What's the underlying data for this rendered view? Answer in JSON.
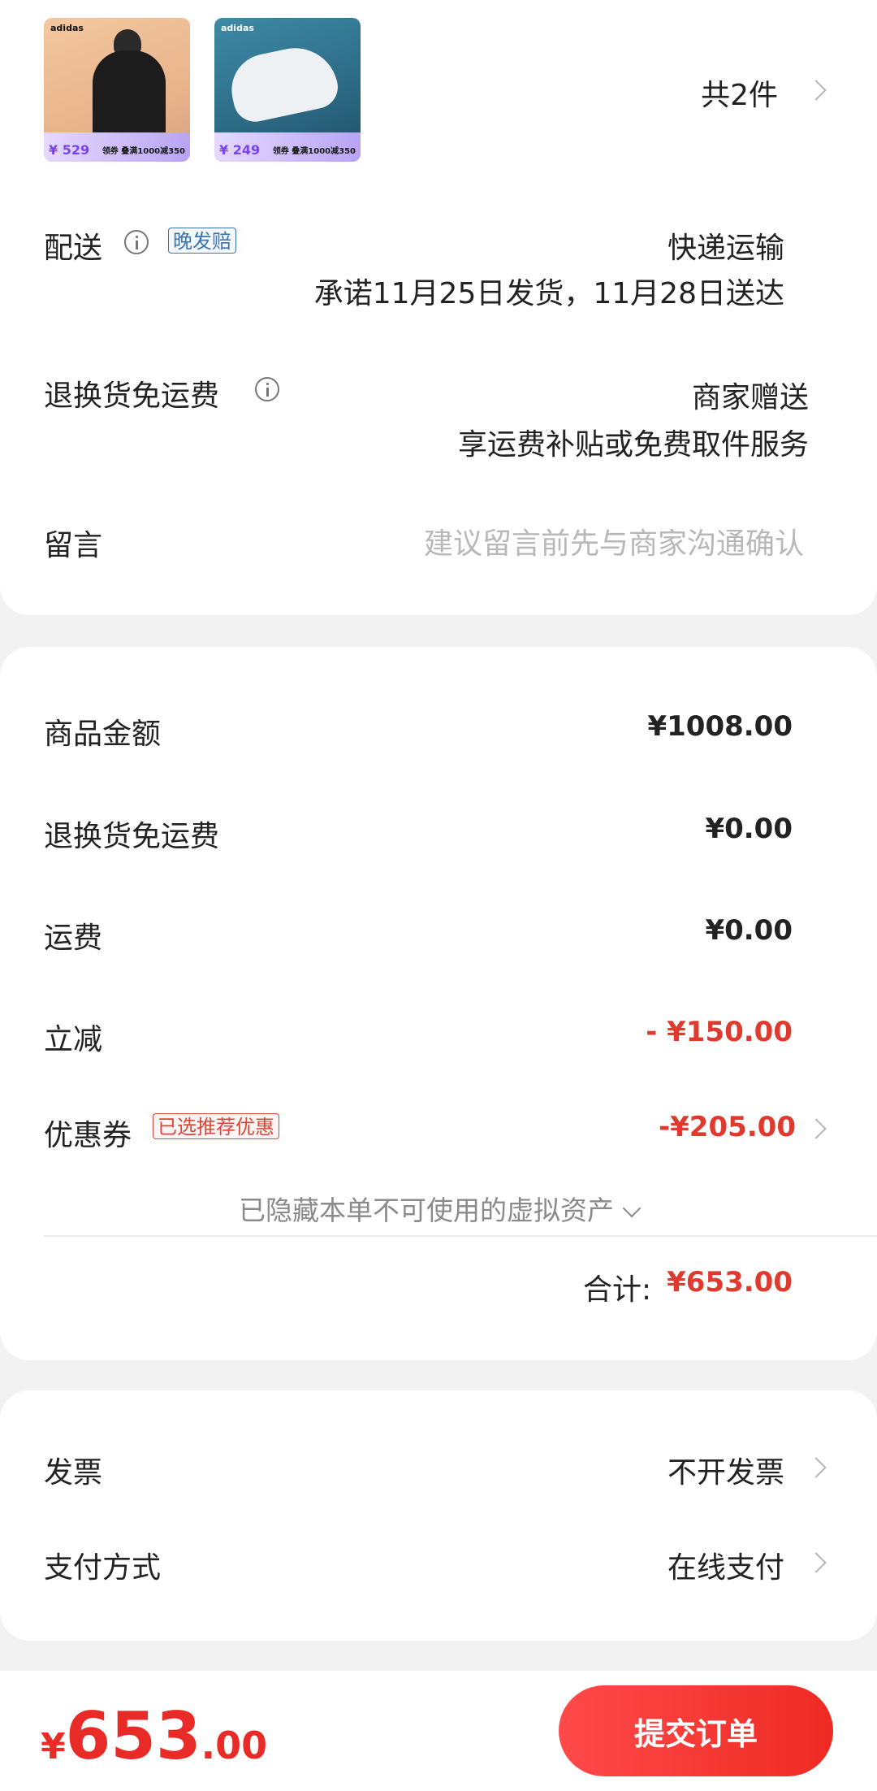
{
  "items": {
    "count_label": "共2件",
    "thumbs": [
      {
        "logo": "adidas",
        "price": "¥ 529",
        "deal": "领券 叠满1000减350"
      },
      {
        "logo": "adidas",
        "price": "¥ 249",
        "deal": "领券 叠满1000减350"
      }
    ]
  },
  "delivery": {
    "label": "配送",
    "tag": "晚发赔",
    "method": "快递运输",
    "promise": "承诺11月25日发货，11月28日送达"
  },
  "return_shipping": {
    "label": "退换货免运费",
    "value": "商家赠送",
    "desc": "享运费补贴或免费取件服务"
  },
  "message": {
    "label": "留言",
    "placeholder": "建议留言前先与商家沟通确认"
  },
  "summary": {
    "goods_amount_label": "商品金额",
    "goods_amount": "¥1008.00",
    "return_fee_label": "退换货免运费",
    "return_fee": "¥0.00",
    "shipping_label": "运费",
    "shipping": "¥0.00",
    "instant_discount_label": "立减",
    "instant_discount": "- ¥150.00",
    "coupon_label": "优惠券",
    "coupon_tag": "已选推荐优惠",
    "coupon_value": "-¥205.00",
    "hidden_assets_note": "已隐藏本单不可使用的虚拟资产",
    "total_label": "合计:",
    "total_value": "¥653.00"
  },
  "invoice": {
    "label": "发票",
    "value": "不开发票"
  },
  "payment": {
    "label": "支付方式",
    "value": "在线支付"
  },
  "footer": {
    "currency": "¥",
    "total_int": "653",
    "total_dec": ".00",
    "submit_label": "提交订单"
  },
  "colors": {
    "accent_red": "#e82b27",
    "tag_blue": "#3a74b4"
  }
}
